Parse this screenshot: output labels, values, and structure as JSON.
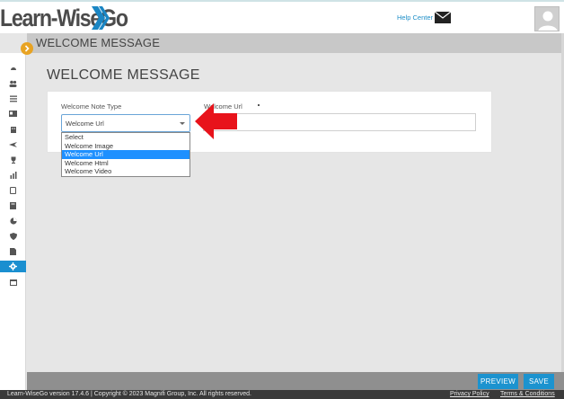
{
  "header": {
    "logo_text": "Learn-WiseGo",
    "help_center": "Help Center",
    "icons": [
      "mail-icon",
      "user-avatar-icon"
    ]
  },
  "title_bar": {
    "title": "WELCOME MESSAGE"
  },
  "sidebar": {
    "icons": [
      "dashboard-icon",
      "users-icon",
      "list-icon",
      "id-card-icon",
      "building-icon",
      "plane-icon",
      "trophy-icon",
      "bar-chart-icon",
      "tablet-icon",
      "book-icon",
      "pie-chart-icon",
      "shield-icon",
      "file-icon",
      "gear-icon",
      "calendar-icon"
    ],
    "active_item": "gear-icon"
  },
  "main": {
    "heading": "WELCOME MESSAGE",
    "form": {
      "note_type_label": "Welcome Note Type",
      "note_type_value": "Welcome Url",
      "note_type_options": [
        "Select",
        "Welcome Image",
        "Welcome Url",
        "Welcome Html",
        "Welcome Video"
      ],
      "note_type_selected": "Welcome Url",
      "url_label": "Welcome Url",
      "url_value": ""
    }
  },
  "actions": {
    "preview": "PREVIEW",
    "save": "SAVE"
  },
  "footer": {
    "copyright": "Learn-WiseGo version 17.4.6 | Copyright © 2023 Magnifi Group, Inc. All rights reserved.",
    "privacy": "Privacy Policy",
    "terms": "Terms & Conditions"
  },
  "colors": {
    "accent": "#1c93cf",
    "toggle": "#e8a323",
    "arrow": "#e8131b",
    "selected_option": "#1e90ff"
  }
}
